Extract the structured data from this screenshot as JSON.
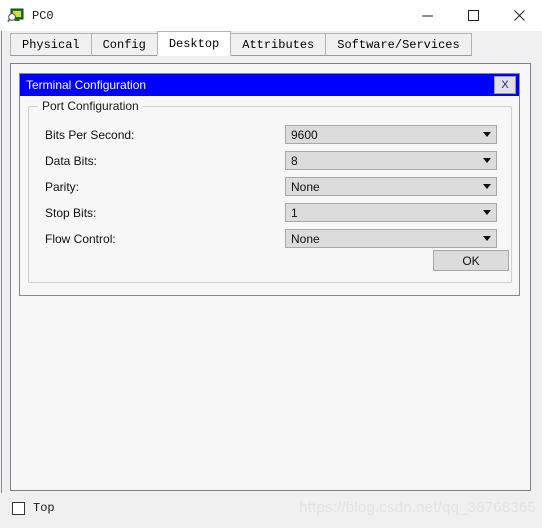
{
  "window": {
    "title": "PC0",
    "icon": "pc-device-icon",
    "controls": {
      "minimize": "minimize-icon",
      "maximize": "maximize-icon",
      "close": "close-icon"
    }
  },
  "tabs": [
    {
      "label": "Physical",
      "selected": false
    },
    {
      "label": "Config",
      "selected": false
    },
    {
      "label": "Desktop",
      "selected": true
    },
    {
      "label": "Attributes",
      "selected": false
    },
    {
      "label": "Software/Services",
      "selected": false
    }
  ],
  "dialog": {
    "title": "Terminal Configuration",
    "close_label": "X",
    "titlebar_color": "#0000ff",
    "group": {
      "legend": "Port Configuration",
      "fields": [
        {
          "label": "Bits Per Second:",
          "value": "9600"
        },
        {
          "label": "Data Bits:",
          "value": "8"
        },
        {
          "label": "Parity:",
          "value": "None"
        },
        {
          "label": "Stop Bits:",
          "value": "1"
        },
        {
          "label": "Flow Control:",
          "value": "None"
        }
      ],
      "ok_label": "OK"
    }
  },
  "bottom": {
    "top_checkbox_label": "Top",
    "top_checked": false,
    "watermark": "https://blog.csdn.net/qq_38768365"
  }
}
